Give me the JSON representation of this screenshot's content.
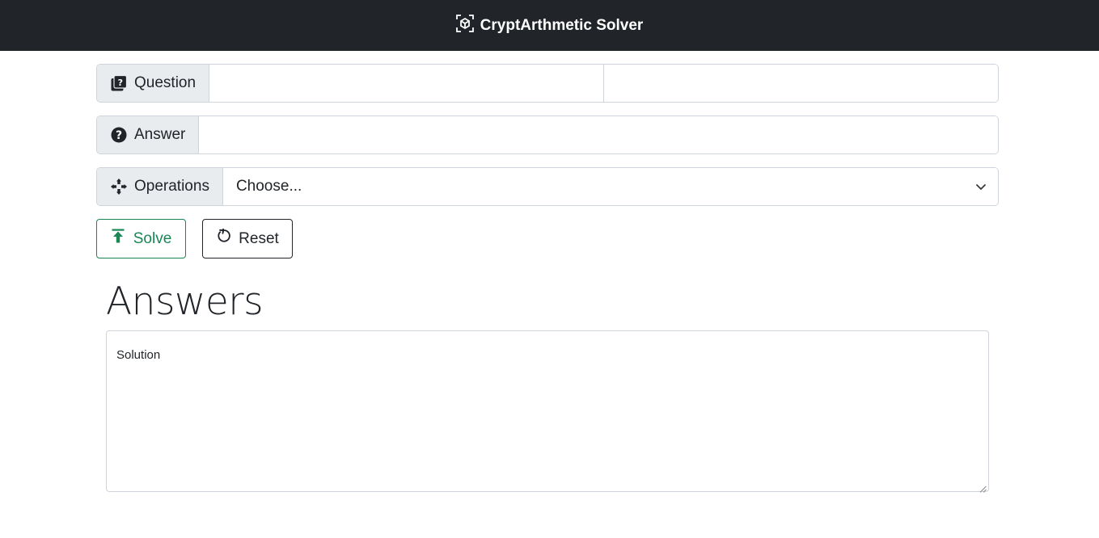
{
  "navbar": {
    "title": "CryptArthmetic Solver",
    "brand_icon": "box-icon",
    "background": "#212529"
  },
  "form": {
    "question": {
      "label": "Question",
      "icon": "question-square-icon",
      "value_left": "",
      "value_right": ""
    },
    "answer": {
      "label": "Answer",
      "icon": "question-circle-icon",
      "value": ""
    },
    "operations": {
      "label": "Operations",
      "icon": "arrows-move-icon",
      "selected": "Choose..."
    }
  },
  "buttons": {
    "solve_label": "Solve",
    "solve_icon": "arrow-bar-up-icon",
    "solve_color": "#198754",
    "reset_label": "Reset",
    "reset_icon": "arrow-counterclockwise-icon"
  },
  "results": {
    "heading": "Answers",
    "placeholder": "Solution"
  }
}
